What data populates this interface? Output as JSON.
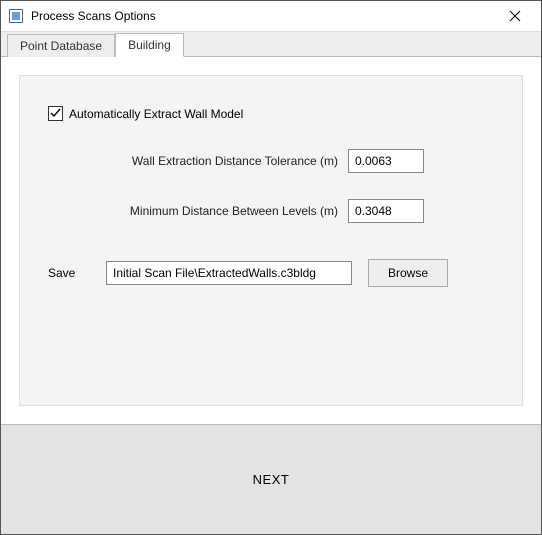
{
  "window": {
    "title": "Process Scans Options"
  },
  "tabs": {
    "point_database": "Point Database",
    "building": "Building",
    "active": "building"
  },
  "building": {
    "auto_extract_label": "Automatically Extract Wall Model",
    "auto_extract_checked": true,
    "tolerance_label": "Wall Extraction Distance Tolerance (m)",
    "tolerance_value": "0.0063",
    "min_dist_label": "Minimum Distance Between Levels (m)",
    "min_dist_value": "0.3048",
    "save_label": "Save",
    "save_path": "Initial Scan File\\ExtractedWalls.c3bldg",
    "browse_label": "Browse"
  },
  "footer": {
    "next_label": "NEXT"
  }
}
